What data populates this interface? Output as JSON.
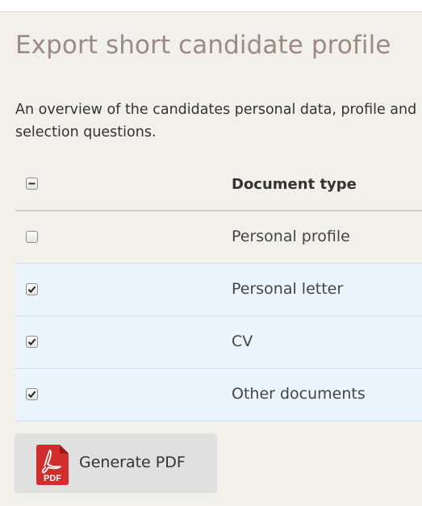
{
  "page": {
    "title": "Export short candidate profile",
    "description": "An overview of the candidates personal data, profile and selection questions."
  },
  "table": {
    "select_all_state": "indeterminate",
    "header": "Document type",
    "rows": [
      {
        "label": "Personal profile",
        "checked": false
      },
      {
        "label": "Personal letter",
        "checked": true
      },
      {
        "label": "CV",
        "checked": true
      },
      {
        "label": "Other documents",
        "checked": true
      }
    ]
  },
  "actions": {
    "generate_label": "Generate PDF",
    "pdf_icon_text": "PDF",
    "pdf_icon_color": "#d22d2d"
  },
  "colors": {
    "title": "#9b8b82",
    "panel_bg": "#f2f0eb",
    "checked_row_bg": "#eaf5fd"
  }
}
